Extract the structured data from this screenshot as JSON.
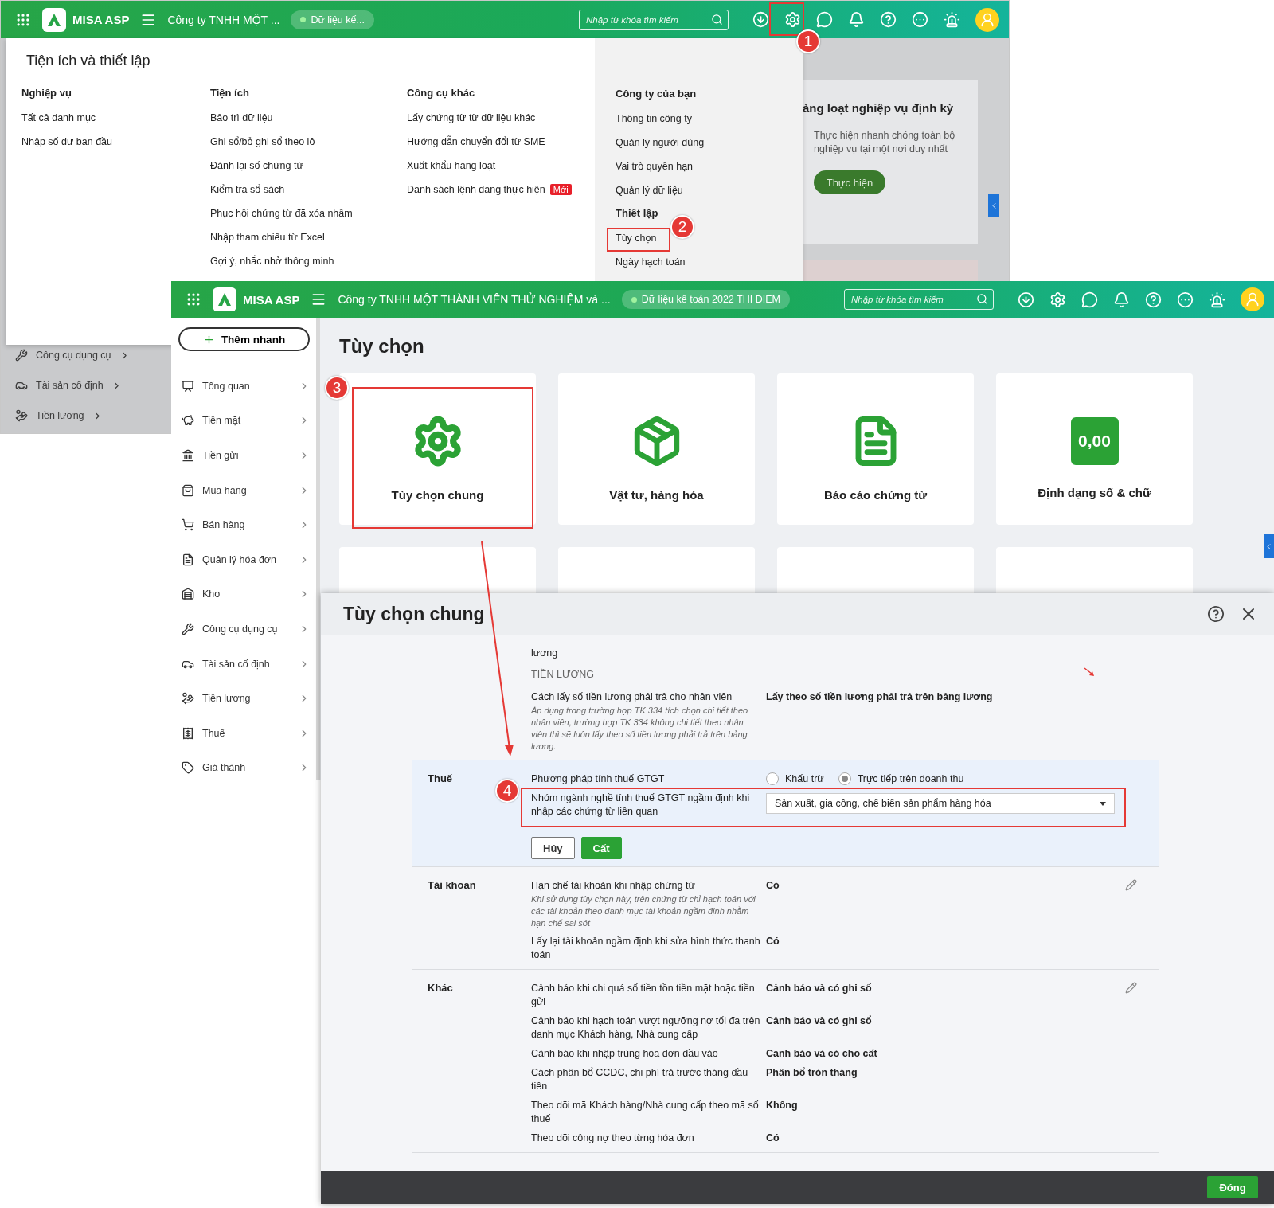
{
  "back_screen": {
    "topbar": {
      "brand": "MISA ASP",
      "company": "Công ty TNHH MỘT ...",
      "data_badge": "Dữ liệu kế...",
      "search": {
        "placeholder": "Nhập từ khóa tìm kiếm"
      }
    },
    "settings_menu": {
      "title": "Tiện ích và thiết lập",
      "columns": [
        {
          "heading": "Nghiệp vụ",
          "items": [
            {
              "label": "Tất cả danh mục"
            },
            {
              "label": "Nhập số dư ban đầu"
            }
          ]
        },
        {
          "heading": "Tiện ích",
          "items": [
            {
              "label": "Bảo trì dữ liệu"
            },
            {
              "label": "Ghi sổ/bỏ ghi sổ theo lô"
            },
            {
              "label": "Đánh lại số chứng từ"
            },
            {
              "label": "Kiểm tra sổ sách"
            },
            {
              "label": "Phục hồi chứng từ đã xóa nhầm"
            },
            {
              "label": "Nhập tham chiếu từ Excel"
            },
            {
              "label": "Gợi ý, nhắc nhở thông minh"
            }
          ]
        },
        {
          "heading": "Công cụ khác",
          "items": [
            {
              "label": "Lấy chứng từ từ dữ liệu khác"
            },
            {
              "label": "Hướng dẫn chuyển đổi từ SME"
            },
            {
              "label": "Xuất khẩu hàng loạt"
            },
            {
              "label": "Danh sách lệnh đang thực hiện",
              "badge": "Mới"
            }
          ]
        },
        {
          "heading": "Công ty của bạn",
          "items": [
            {
              "kind": "link",
              "label": "Thông tin công ty"
            },
            {
              "kind": "link",
              "label": "Quản lý người dùng"
            },
            {
              "kind": "link",
              "label": "Vai trò quyền hạn"
            },
            {
              "kind": "link",
              "label": "Quản lý dữ liệu"
            },
            {
              "kind": "heading",
              "label": "Thiết lập"
            },
            {
              "kind": "link",
              "label": "Tùy chọn"
            },
            {
              "kind": "link",
              "label": "Ngày hạch toán"
            }
          ]
        }
      ]
    },
    "background_card": {
      "title": "àng loạt nghiệp vụ định kỳ",
      "text": "Thực hiện nhanh chóng toàn bộ nghiệp vụ tại một nơi duy nhất",
      "button": "Thực hiện"
    },
    "sidebar_items": [
      "Công cụ dụng cụ",
      "Tài sản cố định",
      "Tiền lương"
    ]
  },
  "front_screen": {
    "topbar": {
      "brand": "MISA ASP",
      "company": "Công ty TNHH MỘT THÀNH VIÊN THỬ NGHIỆM và ...",
      "data_badge": "Dữ liệu kế toán 2022 THI DIEM",
      "search": {
        "placeholder": "Nhập từ khóa tìm kiếm"
      }
    },
    "quick_add": "Thêm nhanh",
    "sidebar": [
      "Tổng quan",
      "Tiền mặt",
      "Tiền gửi",
      "Mua hàng",
      "Bán hàng",
      "Quản lý hóa đơn",
      "Kho",
      "Công cụ dụng cụ",
      "Tài sản cố định",
      "Tiền lương",
      "Thuế",
      "Giá thành"
    ],
    "page_title": "Tùy chọn",
    "tiles": [
      {
        "kind": "gear",
        "label": "Tùy chọn chung"
      },
      {
        "kind": "box",
        "label": "Vật tư, hàng hóa"
      },
      {
        "kind": "report",
        "label": "Báo cáo chứng từ"
      },
      {
        "kind": "number",
        "icon_text": "0,00",
        "label": "Định dạng số & chữ"
      }
    ]
  },
  "dialog": {
    "title": "Tùy chọn chung",
    "sections": [
      {
        "rows": [
          {
            "kind": "text",
            "label": "lương"
          },
          {
            "kind": "subheading",
            "label": "TIỀN LƯƠNG"
          },
          {
            "kind": "text",
            "label": "Cách lấy số tiền lương phải trả cho nhân viên",
            "note": "Áp dụng trong trường hợp TK 334 tích chọn chi tiết theo nhân viên, trường hợp TK 334 không chi tiết theo nhân viên thì sẽ luôn lấy theo số tiền lương phải trả trên bảng lương.",
            "value": "Lấy theo số tiền lương phải trả trên bảng lương"
          }
        ]
      },
      {
        "title": "Thuế",
        "editing": true,
        "rows": [
          {
            "kind": "radio",
            "label": "Phương pháp tính thuế GTGT",
            "options": [
              {
                "label": "Khấu trừ",
                "selected": false
              },
              {
                "label": "Trực tiếp trên doanh thu",
                "selected": true
              }
            ]
          },
          {
            "kind": "select",
            "label": "Nhóm ngành nghề tính thuế GTGT ngầm định khi nhập các chứng từ liên quan",
            "value": "Sản xuất, gia công, chế biến sản phẩm hàng hóa"
          }
        ],
        "actions": {
          "cancel": "Hủy",
          "save": "Cất"
        }
      },
      {
        "title": "Tài khoản",
        "editing": false,
        "rows": [
          {
            "kind": "text",
            "label": "Hạn chế tài khoản khi nhập chứng từ",
            "note": "Khi sử dụng tùy chọn này, trên chứng từ chỉ hạch toán với các tài khoản theo danh mục tài khoản ngầm định nhằm hạn chế sai sót",
            "value": "Có"
          },
          {
            "kind": "text",
            "label": "Lấy lại tài khoản ngầm định khi sửa hình thức thanh toán",
            "value": "Có"
          }
        ]
      },
      {
        "title": "Khác",
        "editing": false,
        "rows": [
          {
            "kind": "text",
            "label": "Cảnh báo khi chi quá số tiền tồn tiền mặt hoặc tiền gửi",
            "value": "Cảnh báo và có ghi sổ"
          },
          {
            "kind": "text",
            "label": "Cảnh báo khi hạch toán vượt ngưỡng nợ tối đa trên danh mục Khách hàng, Nhà cung cấp",
            "value": "Cảnh báo và có ghi sổ"
          },
          {
            "kind": "text",
            "label": "Cảnh báo khi nhập trùng hóa đơn đầu vào",
            "value": "Cảnh báo và có cho cất"
          },
          {
            "kind": "text",
            "label": "Cách phân bổ CCDC, chi phí trả trước tháng đầu tiên",
            "value": "Phân bổ tròn tháng"
          },
          {
            "kind": "text",
            "label": "Theo dõi mã Khách hàng/Nhà cung cấp theo mã số thuế",
            "value": "Không"
          },
          {
            "kind": "text",
            "label": "Theo dõi công nợ theo từng hóa đơn",
            "value": "Có"
          }
        ]
      }
    ],
    "close_button": "Đóng"
  },
  "annotations": [
    {
      "number": "1"
    },
    {
      "number": "2"
    },
    {
      "number": "3"
    },
    {
      "number": "4"
    }
  ]
}
